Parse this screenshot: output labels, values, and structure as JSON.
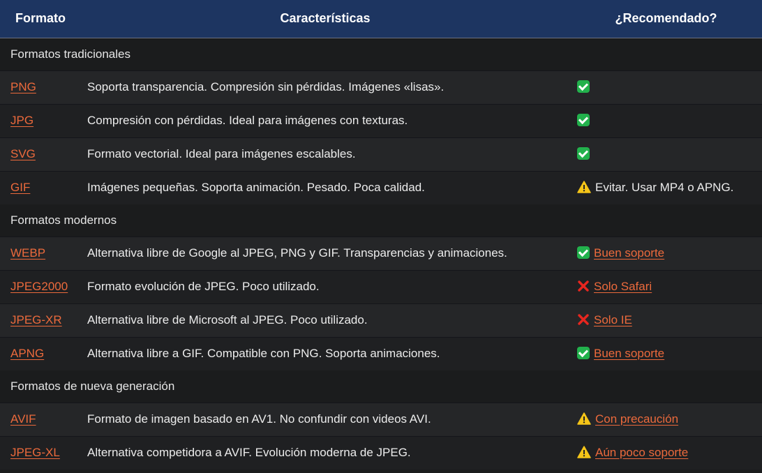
{
  "header": {
    "col_format": "Formato",
    "col_features": "Características",
    "col_recommended": "¿Recomendado?"
  },
  "sections": [
    {
      "title": "Formatos tradicionales",
      "rows": [
        {
          "format": "PNG",
          "description": "Soporta transparencia. Compresión sin pérdidas. Imágenes «lisas».",
          "status_icon": "check-icon",
          "recommendation": "",
          "rec_is_link": false
        },
        {
          "format": "JPG",
          "description": "Compresión con pérdidas. Ideal para imágenes con texturas.",
          "status_icon": "check-icon",
          "recommendation": "",
          "rec_is_link": false
        },
        {
          "format": "SVG",
          "description": "Formato vectorial. Ideal para imágenes escalables.",
          "status_icon": "check-icon",
          "recommendation": "",
          "rec_is_link": false
        },
        {
          "format": "GIF",
          "description": "Imágenes pequeñas. Soporta animación. Pesado. Poca calidad.",
          "status_icon": "warning-icon",
          "recommendation": "Evitar. Usar MP4 o APNG.",
          "rec_is_link": false
        }
      ]
    },
    {
      "title": "Formatos modernos",
      "rows": [
        {
          "format": "WEBP",
          "description": "Alternativa libre de Google al JPEG, PNG y GIF. Transparencias y animaciones.",
          "status_icon": "check-icon",
          "recommendation": "Buen soporte",
          "rec_is_link": true
        },
        {
          "format": "JPEG2000",
          "description": "Formato evolución de JPEG. Poco utilizado.",
          "status_icon": "cross-icon",
          "recommendation": "Solo Safari",
          "rec_is_link": true
        },
        {
          "format": "JPEG-XR",
          "description": "Alternativa libre de Microsoft al JPEG. Poco utilizado.",
          "status_icon": "cross-icon",
          "recommendation": "Solo IE",
          "rec_is_link": true
        },
        {
          "format": "APNG",
          "description": "Alternativa libre a GIF. Compatible con PNG. Soporta animaciones.",
          "status_icon": "check-icon",
          "recommendation": "Buen soporte",
          "rec_is_link": true
        }
      ]
    },
    {
      "title": "Formatos de nueva generación",
      "rows": [
        {
          "format": "AVIF",
          "description": "Formato de imagen basado en AV1. No confundir con videos AVI.",
          "status_icon": "warning-icon",
          "recommendation": "Con precaución",
          "rec_is_link": true
        },
        {
          "format": "JPEG-XL",
          "description": "Alternativa competidora a AVIF. Evolución moderna de JPEG.",
          "status_icon": "warning-icon",
          "recommendation": "Aún poco soporte",
          "rec_is_link": true
        }
      ]
    }
  ],
  "colors": {
    "header_bg": "#1d3561",
    "link": "#ec6a3c",
    "check": "#22b14c",
    "warning": "#f5c518",
    "cross": "#e8261f"
  }
}
